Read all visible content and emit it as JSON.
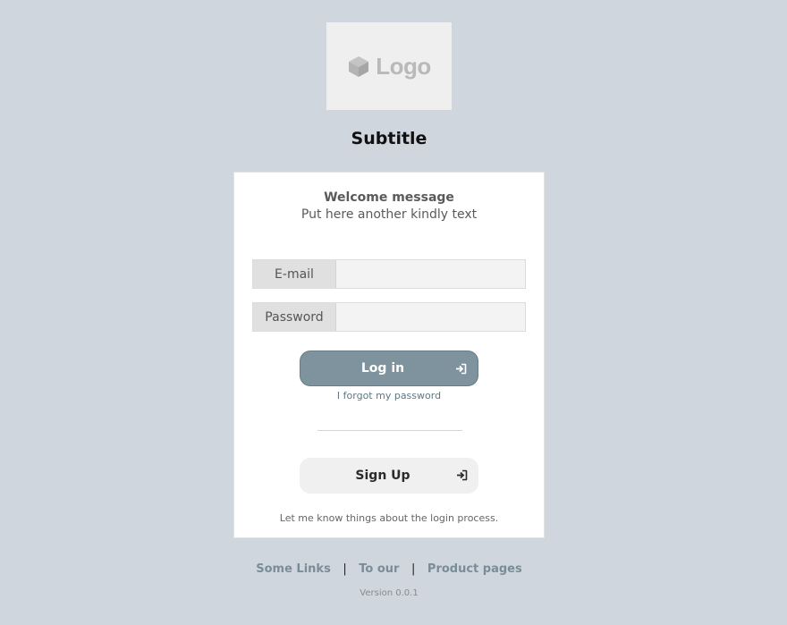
{
  "logo": {
    "text": "Logo",
    "icon": "cube-icon",
    "color": "#b9b9b9"
  },
  "subtitle": "Subtitle",
  "card": {
    "welcome_title": "Welcome message",
    "welcome_text": "Put here another kindly text",
    "email": {
      "label": "E-mail",
      "value": "",
      "placeholder": ""
    },
    "password": {
      "label": "Password",
      "value": "",
      "placeholder": ""
    },
    "login_button": {
      "label": "Log in",
      "icon": "sign-in-icon"
    },
    "forgot_link": "I forgot my password",
    "signup_button": {
      "label": "Sign Up",
      "icon": "sign-in-icon"
    },
    "hint": "Let me know things about the login process."
  },
  "footer": {
    "links": [
      "Some Links",
      "To our",
      "Product pages"
    ],
    "separator": "|",
    "version": "Version 0.0.1"
  },
  "colors": {
    "background": "#d0d6de",
    "primary_button": "#7e939e",
    "link": "#5e7886",
    "footer_link": "#7a8d97"
  }
}
